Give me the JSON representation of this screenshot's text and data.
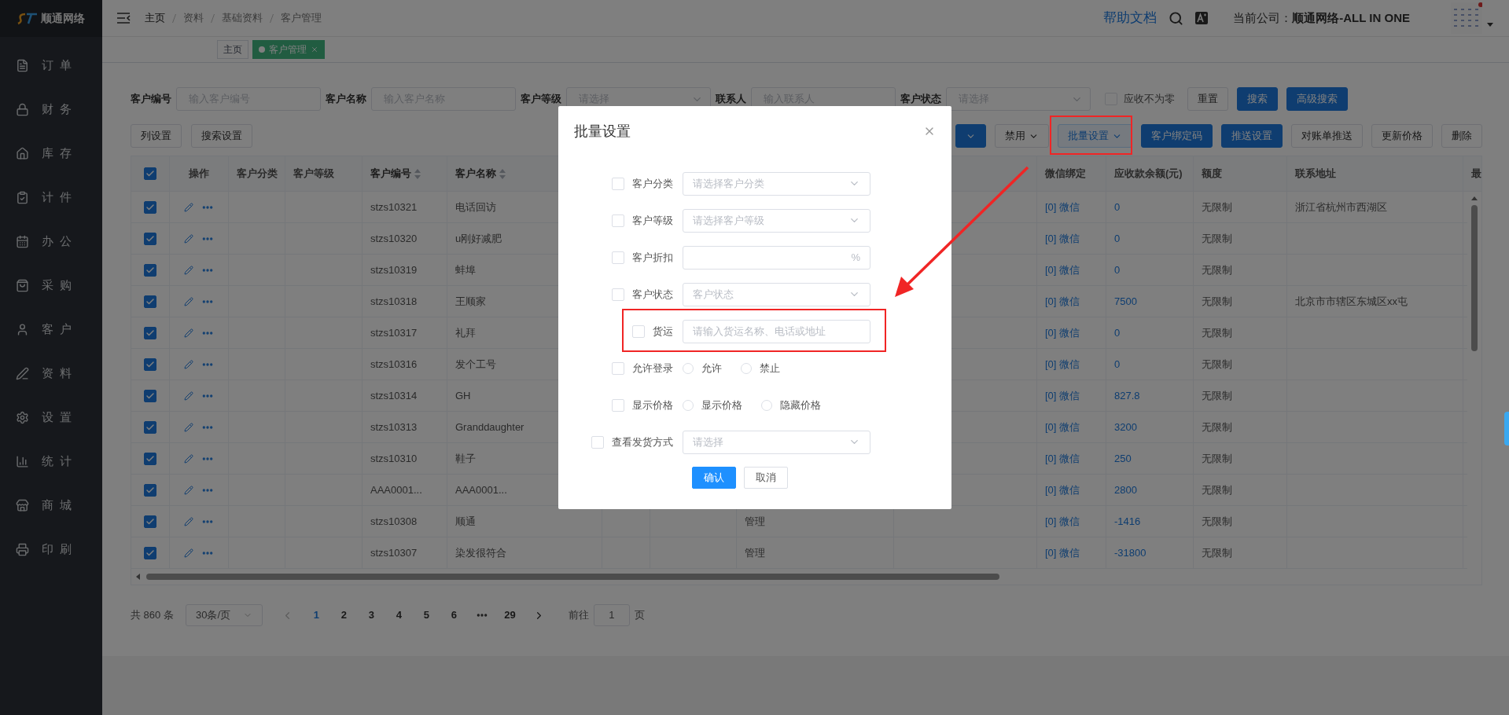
{
  "sidebar": {
    "logo": "顺通网络",
    "items": [
      {
        "label": "订单"
      },
      {
        "label": "财务"
      },
      {
        "label": "库存"
      },
      {
        "label": "计件"
      },
      {
        "label": "办公"
      },
      {
        "label": "采购"
      },
      {
        "label": "客户"
      },
      {
        "label": "资料"
      },
      {
        "label": "设置"
      },
      {
        "label": "统计"
      },
      {
        "label": "商城"
      },
      {
        "label": "印刷"
      }
    ]
  },
  "topbar": {
    "breadcrumb": [
      "主页",
      "资料",
      "基础资料",
      "客户管理"
    ],
    "help": "帮助文档",
    "company_label": "当前公司：",
    "company": "顺通网络-ALL IN ONE"
  },
  "tabs": [
    {
      "label": "主页",
      "selected": false,
      "closable": false
    },
    {
      "label": "客户管理",
      "selected": true,
      "closable": true
    }
  ],
  "filters": [
    {
      "label": "客户编号",
      "kind": "input",
      "placeholder": "输入客户编号"
    },
    {
      "label": "客户名称",
      "kind": "input",
      "placeholder": "输入客户名称"
    },
    {
      "label": "客户等级",
      "kind": "select",
      "placeholder": "请选择"
    },
    {
      "label": "联系人",
      "kind": "input",
      "placeholder": "输入联系人"
    },
    {
      "label": "客户状态",
      "kind": "select",
      "placeholder": "请选择"
    }
  ],
  "nonzero_filter": {
    "label": "应收不为零",
    "checked": false
  },
  "filter_buttons": [
    {
      "label": "重置",
      "primary": false
    },
    {
      "label": "搜索",
      "primary": true
    },
    {
      "label": "高级搜索",
      "primary": true
    }
  ],
  "toolbar_left": [
    {
      "label": "列设置"
    },
    {
      "label": "搜索设置"
    }
  ],
  "toolbar_right": [
    {
      "kind": "dropdown",
      "primary": true,
      "active": false
    },
    {
      "label": "禁用",
      "kind": "dropdown",
      "primary": false,
      "active": false
    },
    {
      "label": "批量设置",
      "kind": "dropdown",
      "primary": false,
      "active": true
    },
    {
      "label": "客户绑定码",
      "kind": "button",
      "primary": true,
      "active": false
    },
    {
      "label": "推送设置",
      "kind": "button",
      "primary": true,
      "active": false
    },
    {
      "label": "对账单推送",
      "kind": "button",
      "primary": false,
      "active": false
    },
    {
      "label": "更新价格",
      "kind": "button",
      "primary": false,
      "active": false
    },
    {
      "label": "删除",
      "kind": "button",
      "primary": false,
      "active": false
    }
  ],
  "table": {
    "all_checked": true,
    "columns": [
      {
        "label": "操作",
        "sortable": false
      },
      {
        "label": "客户分类",
        "sortable": false
      },
      {
        "label": "客户等级",
        "sortable": false
      },
      {
        "label": "客户编号",
        "sortable": true
      },
      {
        "label": "客户名称",
        "sortable": true
      },
      {
        "label": "微信绑定",
        "sortable": false
      },
      {
        "label": "应收款余额(元)",
        "sortable": false
      },
      {
        "label": "额度",
        "sortable": false
      },
      {
        "label": "联系地址",
        "sortable": false
      },
      {
        "label": "最",
        "sortable": false
      }
    ],
    "rows": [
      {
        "checked": true,
        "customer_no": "stzs10321",
        "customer_name": "电话回访",
        "wechat": "[0] 微信",
        "balance": "0",
        "credit_limit": "无限制",
        "address": "浙江省杭州市西湖区"
      },
      {
        "checked": true,
        "customer_no": "stzs10320",
        "customer_name": "u刚好减肥",
        "wechat": "[0] 微信",
        "balance": "0",
        "credit_limit": "无限制"
      },
      {
        "checked": true,
        "customer_no": "stzs10319",
        "customer_name": "蚌埠",
        "wechat": "[0] 微信",
        "balance": "0",
        "credit_limit": "无限制"
      },
      {
        "checked": true,
        "customer_no": "stzs10318",
        "customer_name": "王顺家",
        "wechat": "[0] 微信",
        "balance": "7500",
        "credit_limit": "无限制",
        "address": "北京市市辖区东城区xx屯"
      },
      {
        "checked": true,
        "customer_no": "stzs10317",
        "customer_name": "礼拜",
        "wechat": "[0] 微信",
        "balance": "0",
        "credit_limit": "无限制"
      },
      {
        "checked": true,
        "customer_no": "stzs10316",
        "customer_name": "发个工号",
        "wechat": "[0] 微信",
        "balance": "0",
        "credit_limit": "无限制"
      },
      {
        "checked": true,
        "customer_no": "stzs10314",
        "customer_name": "GH",
        "wechat": "[0] 微信",
        "balance": "827.8",
        "credit_limit": "无限制"
      },
      {
        "checked": true,
        "customer_no": "stzs10313",
        "customer_name": "Granddaughter",
        "wechat": "[0] 微信",
        "balance": "3200",
        "credit_limit": "无限制"
      },
      {
        "checked": true,
        "customer_no": "stzs10310",
        "customer_name": "鞋子",
        "wechat": "[0] 微信",
        "balance": "250",
        "credit_limit": "无限制"
      },
      {
        "checked": true,
        "customer_no": "AAA0001...",
        "customer_name": "AAA0001...",
        "wechat": "[0] 微信",
        "balance": "2800",
        "credit_limit": "无限制"
      },
      {
        "checked": true,
        "customer_no": "stzs10308",
        "customer_name": "顺通",
        "column_9": "管理",
        "wechat": "[0] 微信",
        "balance": "-1416",
        "credit_limit": "无限制"
      },
      {
        "checked": true,
        "customer_no": "stzs10307",
        "customer_name": "染发很符合",
        "column_9": "管理",
        "wechat": "[0] 微信",
        "balance": "-31800",
        "credit_limit": "无限制"
      }
    ]
  },
  "pagination": {
    "total": "共 860 条",
    "page_size": "30条/页",
    "pages": [
      {
        "kind": "page",
        "label": "1",
        "selected": true
      },
      {
        "kind": "page",
        "label": "2",
        "selected": false
      },
      {
        "kind": "page",
        "label": "3",
        "selected": false
      },
      {
        "kind": "page",
        "label": "4",
        "selected": false
      },
      {
        "kind": "page",
        "label": "5",
        "selected": false
      },
      {
        "kind": "page",
        "label": "6",
        "selected": false
      },
      {
        "kind": "ellipsis"
      },
      {
        "kind": "page",
        "label": "29",
        "selected": false
      }
    ],
    "goto_label": "前往",
    "goto_value": "1",
    "goto_suffix": "页"
  },
  "modal": {
    "title": "批量设置",
    "rows": [
      {
        "label": "客户分类",
        "checked": false,
        "kind": "select",
        "placeholder": "请选择客户分类"
      },
      {
        "label": "客户等级",
        "checked": false,
        "kind": "select",
        "placeholder": "请选择客户等级"
      },
      {
        "label": "客户折扣",
        "checked": false,
        "kind": "input",
        "suffix": "%"
      },
      {
        "label": "客户状态",
        "checked": false,
        "kind": "select",
        "placeholder": "客户状态"
      },
      {
        "label": "货运",
        "checked": false,
        "kind": "input",
        "placeholder": "请输入货运名称、电话或地址"
      },
      {
        "label": "允许登录",
        "checked": false,
        "kind": "radio",
        "options": [
          {
            "label": "允许",
            "selected": false
          },
          {
            "label": "禁止",
            "selected": false
          }
        ]
      },
      {
        "label": "显示价格",
        "checked": false,
        "kind": "radio",
        "options": [
          {
            "label": "显示价格",
            "selected": false
          },
          {
            "label": "隐藏价格",
            "selected": false
          }
        ]
      },
      {
        "label": "查看发货方式",
        "checked": false,
        "kind": "select",
        "placeholder": "请选择"
      }
    ],
    "buttons": [
      {
        "label": "确认",
        "primary": true
      },
      {
        "label": "取消",
        "primary": false
      }
    ]
  }
}
